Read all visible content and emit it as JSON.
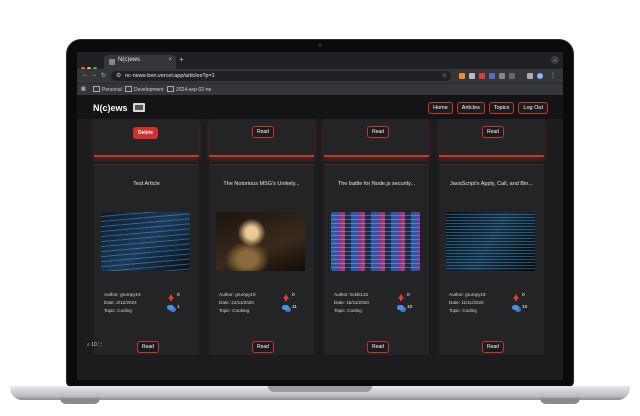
{
  "browser": {
    "tab_title": "N(c)ews",
    "tab_close": "×",
    "new_tab": "+",
    "tab_menu": "⌄",
    "url": "nc-news-ben.vercel.app/articles?p=1",
    "nav": {
      "back": "←",
      "forward": "→",
      "reload": "↻"
    },
    "bookmarks": [
      "Personal",
      "Development",
      "2024-sep-02-ne"
    ]
  },
  "app": {
    "logo": "N(c)ews",
    "nav": [
      "Home",
      "Articles",
      "Topics",
      "Log Out"
    ]
  },
  "top_row": {
    "delete_label": "Delete",
    "read_label": "Read"
  },
  "articles": [
    {
      "title": "Test Article",
      "author": "Author: grumpy19",
      "date": "Date: 2/12/2024",
      "topic": "Topic: Coding",
      "votes": "0",
      "comments": "1",
      "read": "Read"
    },
    {
      "title": "The Notorious MSG's Unikely...",
      "author": "Author: grumpy19",
      "date": "Date: 22/11/2020",
      "topic": "Topic: Cooking",
      "votes": "0",
      "comments": "11",
      "read": "Read"
    },
    {
      "title": "The battle for Node.js security...",
      "author": "Author: tickle122",
      "date": "Date: 15/11/2020",
      "topic": "Topic: Coding",
      "votes": "0",
      "comments": "10",
      "read": "Read"
    },
    {
      "title": "JavaScript's Apply, Call, and Bin...",
      "author": "Author: grumpy19",
      "date": "Date: 11/11/2020",
      "topic": "Topic: Coding",
      "votes": "0",
      "comments": "10",
      "read": "Read"
    }
  ],
  "floating": "⌕ 10 ⛶",
  "colors": {
    "accent": "#c0392b",
    "delete": "#d32f2f",
    "comment": "#4a90e2"
  }
}
